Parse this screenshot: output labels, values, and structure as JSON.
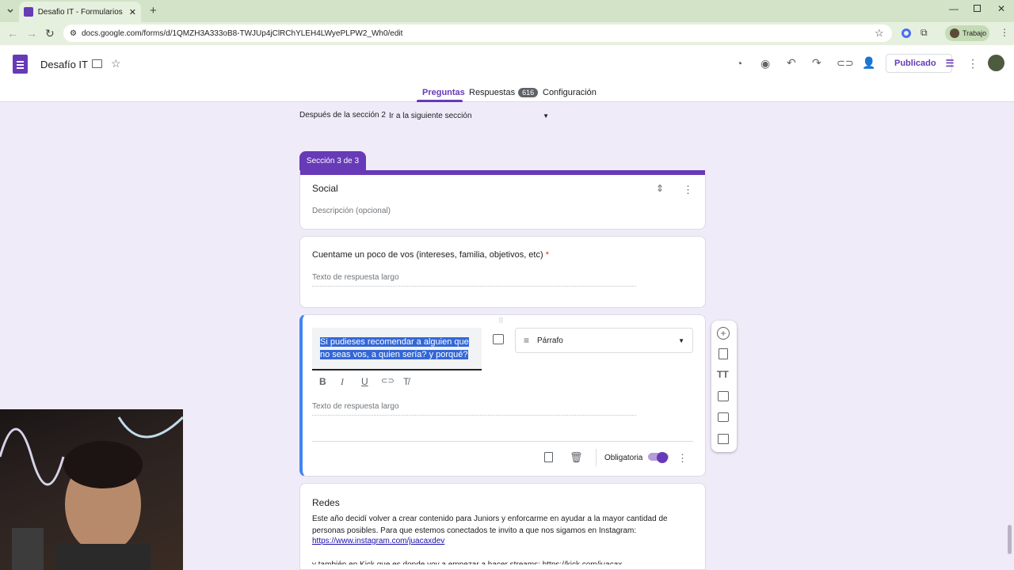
{
  "browser": {
    "tab_title": "Desafio IT - Formularios de Goo",
    "url": "docs.google.com/forms/d/1QMZH3A333oB8-TWJUp4jClRChYLEH4LWyePLPW2_Wh0/edit",
    "profile_label": "Trabajo"
  },
  "form": {
    "title": "Desafío IT",
    "publish_label": "Publicado",
    "tabs": [
      {
        "label": "Preguntas"
      },
      {
        "label": "Respuestas",
        "badge": "616"
      },
      {
        "label": "Configuración"
      }
    ]
  },
  "section_nav": {
    "label": "Después de la sección 2",
    "value": "Ir a la siguiente sección"
  },
  "section": {
    "tag": "Sección 3 de 3",
    "title": "Social",
    "description_placeholder": "Descripción (opcional)"
  },
  "question1": {
    "text": "Cuentame un poco de vos (intereses, familia, objetivos, etc)",
    "required_mark": "*",
    "answer_placeholder": "Texto de respuesta largo"
  },
  "question2": {
    "line1": "Si pudieses recomendar a alguien que",
    "line2": "no seas vos, a quien sería? y porqué?",
    "type_label": "Párrafo",
    "answer_placeholder": "Texto de respuesta largo",
    "required_label": "Obligatoria",
    "required_on": true
  },
  "redes": {
    "title": "Redes",
    "body": "Este año decidí volver a crear contenido para Juniors y enforcarme en ayudar a la mayor cantidad de personas posibles. Para que estemos conectados te invito a que nos sigamos en Instagram:",
    "link": "https://www.instagram.com/juacaxdev",
    "partial": "y también en Kick que es donde voy a empezar a hacer streams: https://kick.com/juacax"
  },
  "colors": {
    "accent": "#673ab7",
    "bg": "#f0ebf8",
    "chrome": "#d3e3c8"
  }
}
